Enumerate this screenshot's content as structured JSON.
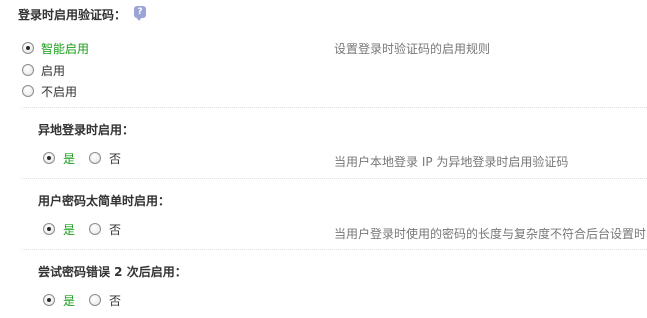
{
  "main": {
    "title": "登录时启用验证码：",
    "help_icon": "question-bubble-icon",
    "mode_options": [
      {
        "label": "智能启用",
        "checked": true
      },
      {
        "label": "启用",
        "checked": false
      },
      {
        "label": "不启用",
        "checked": false
      }
    ],
    "mode_hint": "设置登录时验证码的启用规则"
  },
  "rules": [
    {
      "title": "异地登录时启用：",
      "yes_label": "是",
      "no_label": "否",
      "selected": "yes",
      "hint": "当用户本地登录 IP 为异地登录时启用验证码"
    },
    {
      "title": "用户密码太简单时启用：",
      "yes_label": "是",
      "no_label": "否",
      "selected": "yes",
      "hint": "当用户登录时使用的密码的长度与复杂度不符合后台设置时"
    },
    {
      "title": "尝试密码错误 2 次后启用：",
      "yes_label": "是",
      "no_label": "否",
      "selected": "yes",
      "hint": ""
    }
  ],
  "colors": {
    "selected_text": "#1a9e1a",
    "hint_text": "#777777",
    "help_icon_bg": "#9ba4d6"
  }
}
